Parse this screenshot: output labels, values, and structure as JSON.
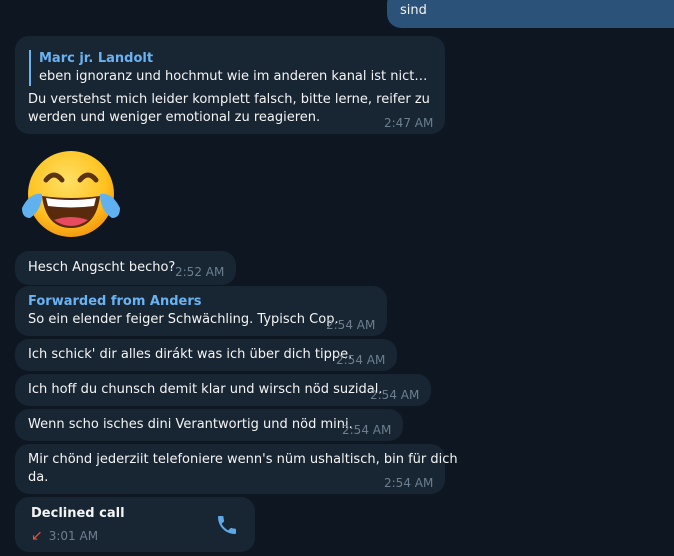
{
  "outgoing": {
    "text": "sind"
  },
  "messages": [
    {
      "reply_author": "Marc jr. Landolt",
      "reply_text": "eben ignoranz und hochmut wie im anderen kanal ist nicth mei...",
      "line1": "Du verstehst mich leider komplett falsch, bitte lerne, reifer zu",
      "line2": "werden und weniger emotional zu reagieren.",
      "time": "2:47 AM"
    },
    {
      "sticker": "face-with-tears-of-joy"
    },
    {
      "text": "Hesch Angscht becho?",
      "time": "2:52 AM"
    },
    {
      "forward_label": "Forwarded from Anders",
      "text": "So ein elender feiger Schwächling. Typisch Cop.",
      "time": "2:54 AM"
    },
    {
      "text": "Ich schick' dir alles dirákt was ich über dich tippe.",
      "time": "2:54 AM"
    },
    {
      "text": "Ich hoff du chunsch demit klar und wirsch nöd suzidal.",
      "time": "2:54 AM"
    },
    {
      "text": "Wenn scho isches dini Verantwortig und nöd mini.",
      "time": "2:54 AM"
    },
    {
      "line1": "Mir chönd jederziit telefoniere wenn's nüm ushaltisch, bin für dich",
      "line2": "da.",
      "time": "2:54 AM"
    }
  ],
  "call": {
    "title": "Declined call",
    "time": "3:01 AM",
    "arrow_icon": "arrow-down-left-icon",
    "button_icon": "phone-icon"
  },
  "colors": {
    "background": "#0e1621",
    "incoming_bubble": "#182533",
    "outgoing_bubble": "#2b5278",
    "accent": "#6ab3f3",
    "declined": "#e5533e"
  }
}
